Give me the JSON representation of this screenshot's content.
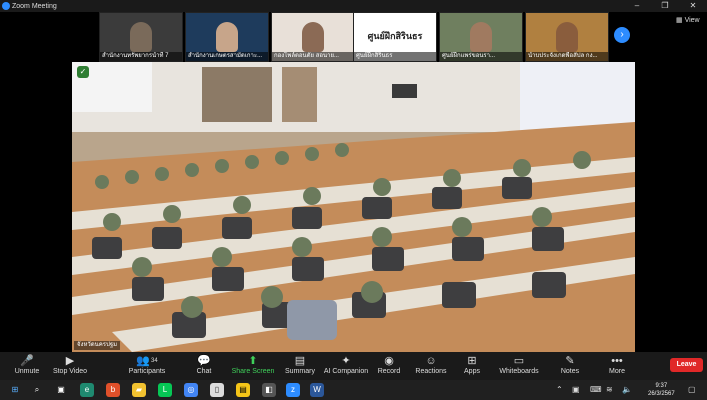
{
  "window": {
    "title": "Zoom Meeting",
    "controls": [
      "–",
      "❐",
      "✕"
    ]
  },
  "gallery": {
    "participants": [
      {
        "name": "สำนักงานทรัพยากรน้ำที่ 7"
      },
      {
        "name": "สำนักงานเกษตรสามัดเกาะ..."
      },
      {
        "name": "กองโพล์ตอนตัย สอนาย..."
      },
      {
        "name": "ศูนย์ฝึกสิรินธร",
        "card_text": "ศูนย์ฝึกสิรินธร"
      },
      {
        "name": "ศูนย์ฝึกแพร่ขอนรา..."
      },
      {
        "name": "นำบประจังเกดพื่อสัปล กง..."
      }
    ],
    "next_label": "›",
    "view_label": "View"
  },
  "main_video": {
    "name": "จังหวัดนครปฐม",
    "security_icon": "shield-icon"
  },
  "toolbar": {
    "unmute": "Unmute",
    "stop_video": "Stop Video",
    "participants": "Participants",
    "participants_count": "34",
    "chat": "Chat",
    "share_screen": "Share Screen",
    "summary": "Summary",
    "ai_companion": "AI Companion",
    "record": "Record",
    "reactions": "Reactions",
    "apps": "Apps",
    "whiteboards": "Whiteboards",
    "notes": "Notes",
    "more": "More",
    "leave": "Leave"
  },
  "taskbar": {
    "time": "9:37",
    "date": "26/3/2567"
  },
  "colors": {
    "accent": "#2d8cff",
    "leave": "#e02828",
    "share": "#3fcf5a"
  }
}
